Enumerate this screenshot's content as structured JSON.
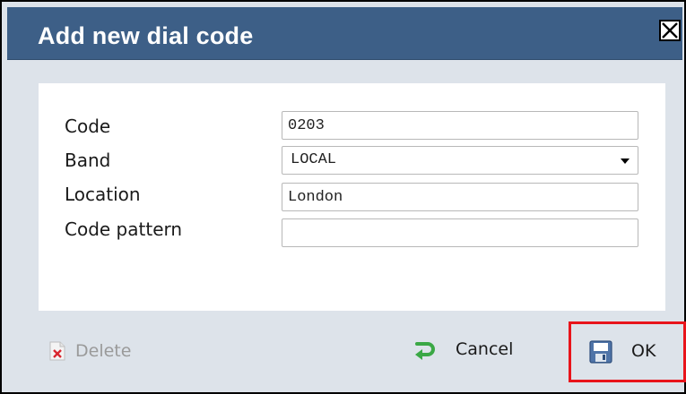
{
  "dialog": {
    "title": "Add new dial code",
    "close_icon": "close-icon"
  },
  "form": {
    "code": {
      "label": "Code",
      "value": "0203"
    },
    "band": {
      "label": "Band",
      "selected": "LOCAL"
    },
    "location": {
      "label": "Location",
      "value": "London"
    },
    "code_pattern": {
      "label": "Code pattern",
      "value": ""
    }
  },
  "footer": {
    "delete": {
      "label": "Delete",
      "icon": "delete-icon",
      "enabled": false
    },
    "cancel": {
      "label": "Cancel",
      "icon": "undo-arrow-icon"
    },
    "ok": {
      "label": "OK",
      "icon": "save-disk-icon",
      "highlighted": true
    }
  },
  "colors": {
    "titlebar": "#3d5f87",
    "dialog_background": "#dde3ea",
    "highlight": "#e8141b",
    "cancel_icon": "#3aa845",
    "delete_icon": "#d9262e"
  }
}
